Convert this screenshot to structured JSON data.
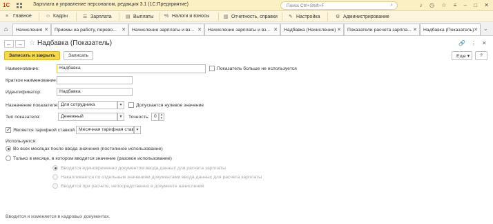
{
  "app": {
    "logo": "1С",
    "title": "Зарплата и управление персоналом, редакция 3.1  (1С:Предприятие)",
    "search_placeholder": "Поиск Ctrl+Shift+F"
  },
  "menu": [
    {
      "label": "Главное",
      "icon": "menu-icon"
    },
    {
      "label": "Кадры",
      "icon": "people-icon"
    },
    {
      "label": "Зарплата",
      "icon": "list-icon"
    },
    {
      "label": "Выплаты",
      "icon": "wallet-icon"
    },
    {
      "label": "Налоги и взносы",
      "icon": "percent-icon"
    },
    {
      "label": "Отчетность, справки",
      "icon": "report-icon"
    },
    {
      "label": "Настройка",
      "icon": "wrench-icon"
    },
    {
      "label": "Администрирование",
      "icon": "gear-icon"
    }
  ],
  "tabs": [
    "Начисления",
    "Приемы на работу, перево...",
    "Начисление зарплаты и вз...",
    "Начисление зарплаты и вз...",
    "Надбавка (Начисление)",
    "Показатели расчета зарпла...",
    "Надбавка (Показатель)"
  ],
  "form": {
    "title": "Надбавка (Показатель)",
    "save_close": "Записать и закрыть",
    "save": "Записать",
    "more": "Еще",
    "help": "?",
    "fields": {
      "name_label": "Наименование:",
      "name_value": "Надбавка",
      "unused_label": "Показатель больше не используется",
      "short_name_label": "Краткое наименование:",
      "short_name_value": "",
      "id_label": "Идентификатор:",
      "id_value": "Надбавка",
      "purpose_label": "Назначение показателя:",
      "purpose_value": "Для сотрудника",
      "zero_label": "Допускается нулевое значение",
      "type_label": "Тип показателя:",
      "type_value": "Денежный",
      "precision_label": "Точность:",
      "precision_value": "0",
      "tariff_label": "Является тарифной ставкой",
      "tariff_value": "Месячная тарифная ставк"
    },
    "usage": {
      "label": "Используется:",
      "options": [
        "Во всех месяцах после ввода значения (постоянное использование)",
        "Только в месяце, в котором вводится значение (разовое использование)"
      ],
      "sub_options": [
        "Вводится единовременно документом ввода данных для расчета зарплаты",
        "Накапливается по отдельным значениям документами ввода данных для расчета зарплаты",
        "Вводится при расчете, непосредственно в документе начисления"
      ]
    },
    "footer_note": "Вводится и изменяется в кадровых документах."
  }
}
